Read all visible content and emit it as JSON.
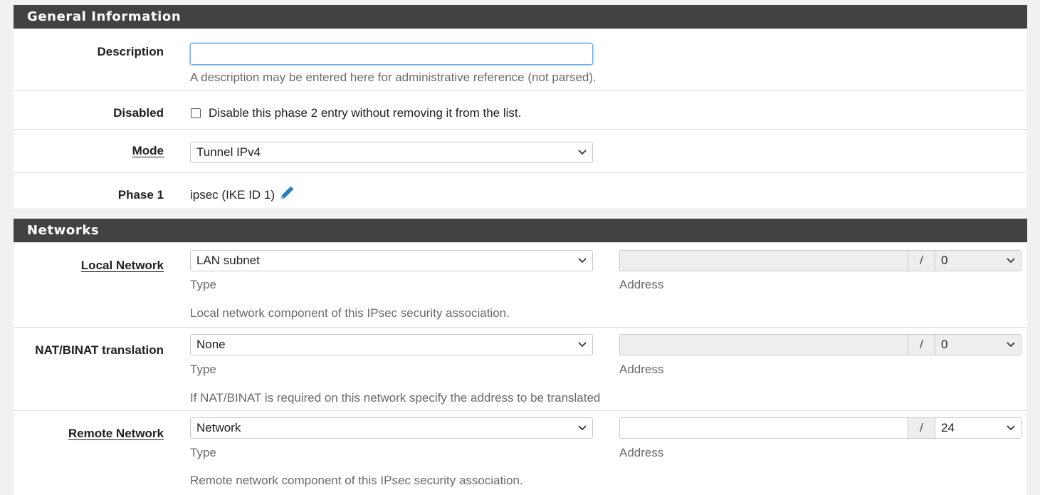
{
  "general": {
    "heading": "General Information",
    "description": {
      "label": "Description",
      "value": "",
      "placeholder": "",
      "help": "A description may be entered here for administrative reference (not parsed)."
    },
    "disabled": {
      "label": "Disabled",
      "checked": false,
      "text": "Disable this phase 2 entry without removing it from the list."
    },
    "mode": {
      "label": "Mode",
      "value": "Tunnel IPv4"
    },
    "phase1": {
      "label": "Phase 1",
      "value": "ipsec (IKE ID 1)",
      "icon": "pencil-icon",
      "icon_color": "#2e7abf"
    }
  },
  "networks": {
    "heading": "Networks",
    "local": {
      "label": "Local Network",
      "type_value": "LAN subnet",
      "type_caption": "Type",
      "address_value": "",
      "address_caption": "Address",
      "slash": "/",
      "mask": "0",
      "help": "Local network component of this IPsec security association."
    },
    "natbinat": {
      "label": "NAT/BINAT translation",
      "type_value": "None",
      "type_caption": "Type",
      "address_value": "",
      "address_caption": "Address",
      "slash": "/",
      "mask": "0",
      "help": "If NAT/BINAT is required on this network specify the address to be translated"
    },
    "remote": {
      "label": "Remote Network",
      "type_value": "Network",
      "type_caption": "Type",
      "address_value": "",
      "address_caption": "Address",
      "slash": "/",
      "mask": "24",
      "help": "Remote network component of this IPsec security association."
    }
  },
  "colors": {
    "heading_bg": "#424242",
    "focus_border": "#66afe9",
    "help_text": "#6a6a6a"
  }
}
